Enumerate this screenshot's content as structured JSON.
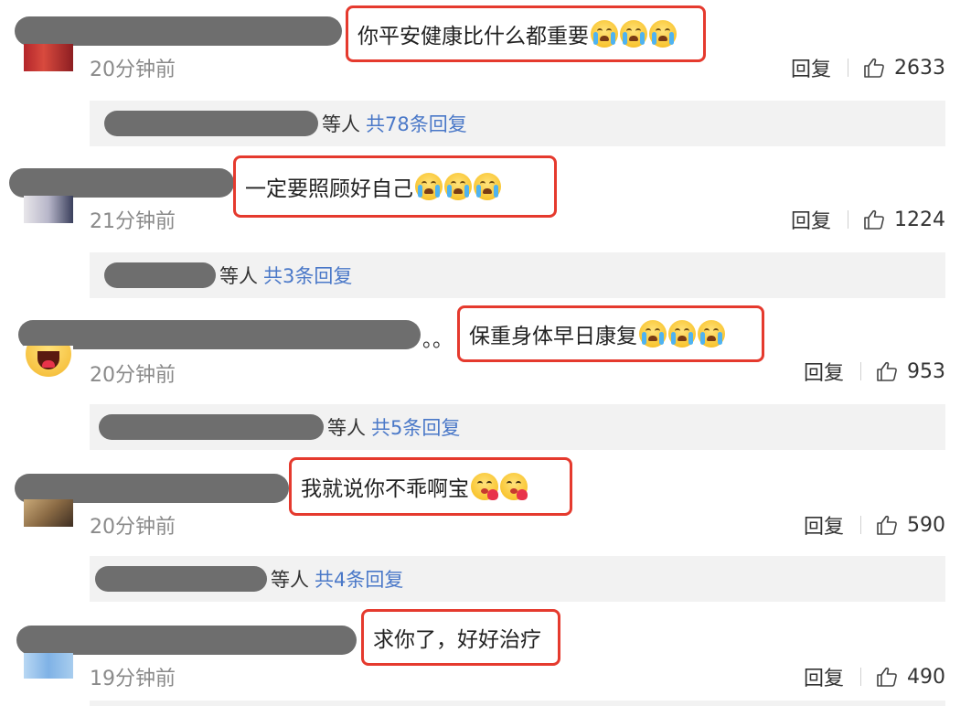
{
  "comments": [
    {
      "text": "你平安健康比什么都重要",
      "emoji": [
        "crying-face-icon",
        "crying-face-icon",
        "crying-face-icon"
      ],
      "time": "20分钟前",
      "reply_label": "回复",
      "likes": "2633",
      "replies_suffix": "等人",
      "replies_link": "共78条回复"
    },
    {
      "text": "一定要照顾好自己",
      "emoji": [
        "crying-face-icon",
        "crying-face-icon",
        "crying-face-icon"
      ],
      "time": "21分钟前",
      "reply_label": "回复",
      "likes": "1224",
      "replies_suffix": "等人",
      "replies_link": "共3条回复"
    },
    {
      "prefix": "。。",
      "text": "保重身体早日康复",
      "emoji": [
        "crying-face-icon",
        "crying-face-icon",
        "crying-face-icon"
      ],
      "time": "20分钟前",
      "reply_label": "回复",
      "likes": "953",
      "replies_suffix": "等人",
      "replies_link": "共5条回复"
    },
    {
      "text": "我就说你不乖啊宝",
      "emoji": [
        "kiss-face-icon",
        "kiss-face-icon"
      ],
      "time": "20分钟前",
      "reply_label": "回复",
      "likes": "590",
      "replies_suffix": "等人",
      "replies_link": "共4条回复"
    },
    {
      "text": "求你了，好好治疗",
      "emoji": [],
      "time": "19分钟前",
      "reply_label": "回复",
      "likes": "490"
    }
  ],
  "colors": {
    "highlight_border": "#e53a2e",
    "link_blue": "#4a78c8",
    "sub_bar_bg": "#f2f2f2",
    "redaction": "#6e6e6e"
  }
}
